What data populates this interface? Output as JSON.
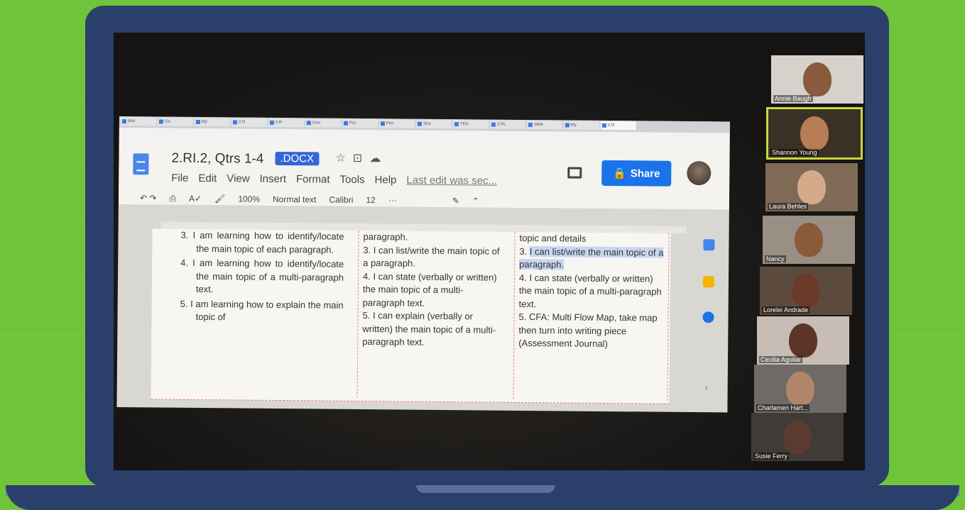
{
  "doc": {
    "tabs": [
      "Wel",
      "Go",
      "My",
      "2.R",
      "2.R",
      "Goo",
      "Pro",
      "Pen",
      "Sha",
      "TEA",
      "2.RL",
      "SMA",
      "My",
      "2.R"
    ],
    "title": "2.RI.2, Qtrs 1-4",
    "badge": ".DOCX",
    "menus": [
      "File",
      "Edit",
      "View",
      "Insert",
      "Format",
      "Tools",
      "Help"
    ],
    "last_edit": "Last edit was sec...",
    "share_label": "Share",
    "toolbar": {
      "zoom": "100%",
      "style": "Normal text",
      "font": "Calibri",
      "size": "12",
      "more": "···"
    },
    "col1": {
      "items": [
        "3.  I am learning how to identify/locate the main topic of each paragraph.",
        "4.  I am learning how to identify/locate the main topic of a multi-paragraph text.",
        "5.  I am learning how to explain the main topic of"
      ]
    },
    "col2": {
      "lines": [
        "paragraph.",
        "3.  I can list/write the main topic of a paragraph.",
        "4.  I can state (verbally or written) the main topic of a multi-paragraph text.",
        "5.  I can explain (verbally or written) the main topic of a multi-paragraph text."
      ]
    },
    "col3": {
      "first": "topic and details",
      "hl_prefix": "3.",
      "hl_text": "I can list/write the main topic of a paragraph.",
      "rest": [
        "4.  I can state (verbally or written) the main topic of a multi-paragraph text.",
        "5.  CFA: Multi Flow Map, take map then turn into writing piece (Assessment Journal)"
      ]
    }
  },
  "participants": [
    {
      "name": "Annie Baugh"
    },
    {
      "name": "Shannon Young"
    },
    {
      "name": "Laura Behles"
    },
    {
      "name": "Nancy"
    },
    {
      "name": "Lorelei Andrade"
    },
    {
      "name": "Cecilia Aguilar"
    },
    {
      "name": "Charlamen Hart..."
    },
    {
      "name": "Susie Ferry"
    }
  ],
  "colors": {
    "background": "#6fc43a",
    "laptop": "#2b3f6b",
    "share": "#1a73e8",
    "speaking_outline": "#c8d938"
  }
}
